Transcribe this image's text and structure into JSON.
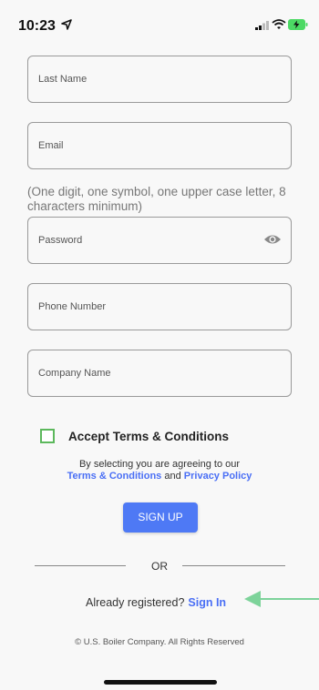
{
  "status_bar": {
    "time": "10:23"
  },
  "fields": {
    "last_name": {
      "placeholder": "Last Name"
    },
    "email": {
      "placeholder": "Email"
    },
    "password_hint": "(One digit, one symbol, one upper case letter, 8 characters minimum)",
    "password": {
      "placeholder": "Password"
    },
    "phone": {
      "placeholder": "Phone Number"
    },
    "company": {
      "placeholder": "Company Name"
    }
  },
  "terms": {
    "checkbox_label": "Accept Terms & Conditions",
    "checked": false,
    "consent_text": "By selecting you are agreeing to our",
    "terms_link": "Terms & Conditions",
    "and_text": "and",
    "privacy_link": "Privacy Policy"
  },
  "signup_button": "SIGN UP",
  "or_text": "OR",
  "signin": {
    "prompt": "Already registered?",
    "link": "Sign In"
  },
  "copyright": "© U.S. Boiler Company. All Rights Reserved",
  "colors": {
    "accent": "#4e79f5",
    "link": "#4a6ff5",
    "checkbox_border": "#5cb85c",
    "annotation_arrow": "#7dd39a"
  },
  "icons": [
    "location-arrow-icon",
    "signal-icon",
    "wifi-icon",
    "battery-charging-icon",
    "eye-icon",
    "annotation-arrow-icon"
  ]
}
